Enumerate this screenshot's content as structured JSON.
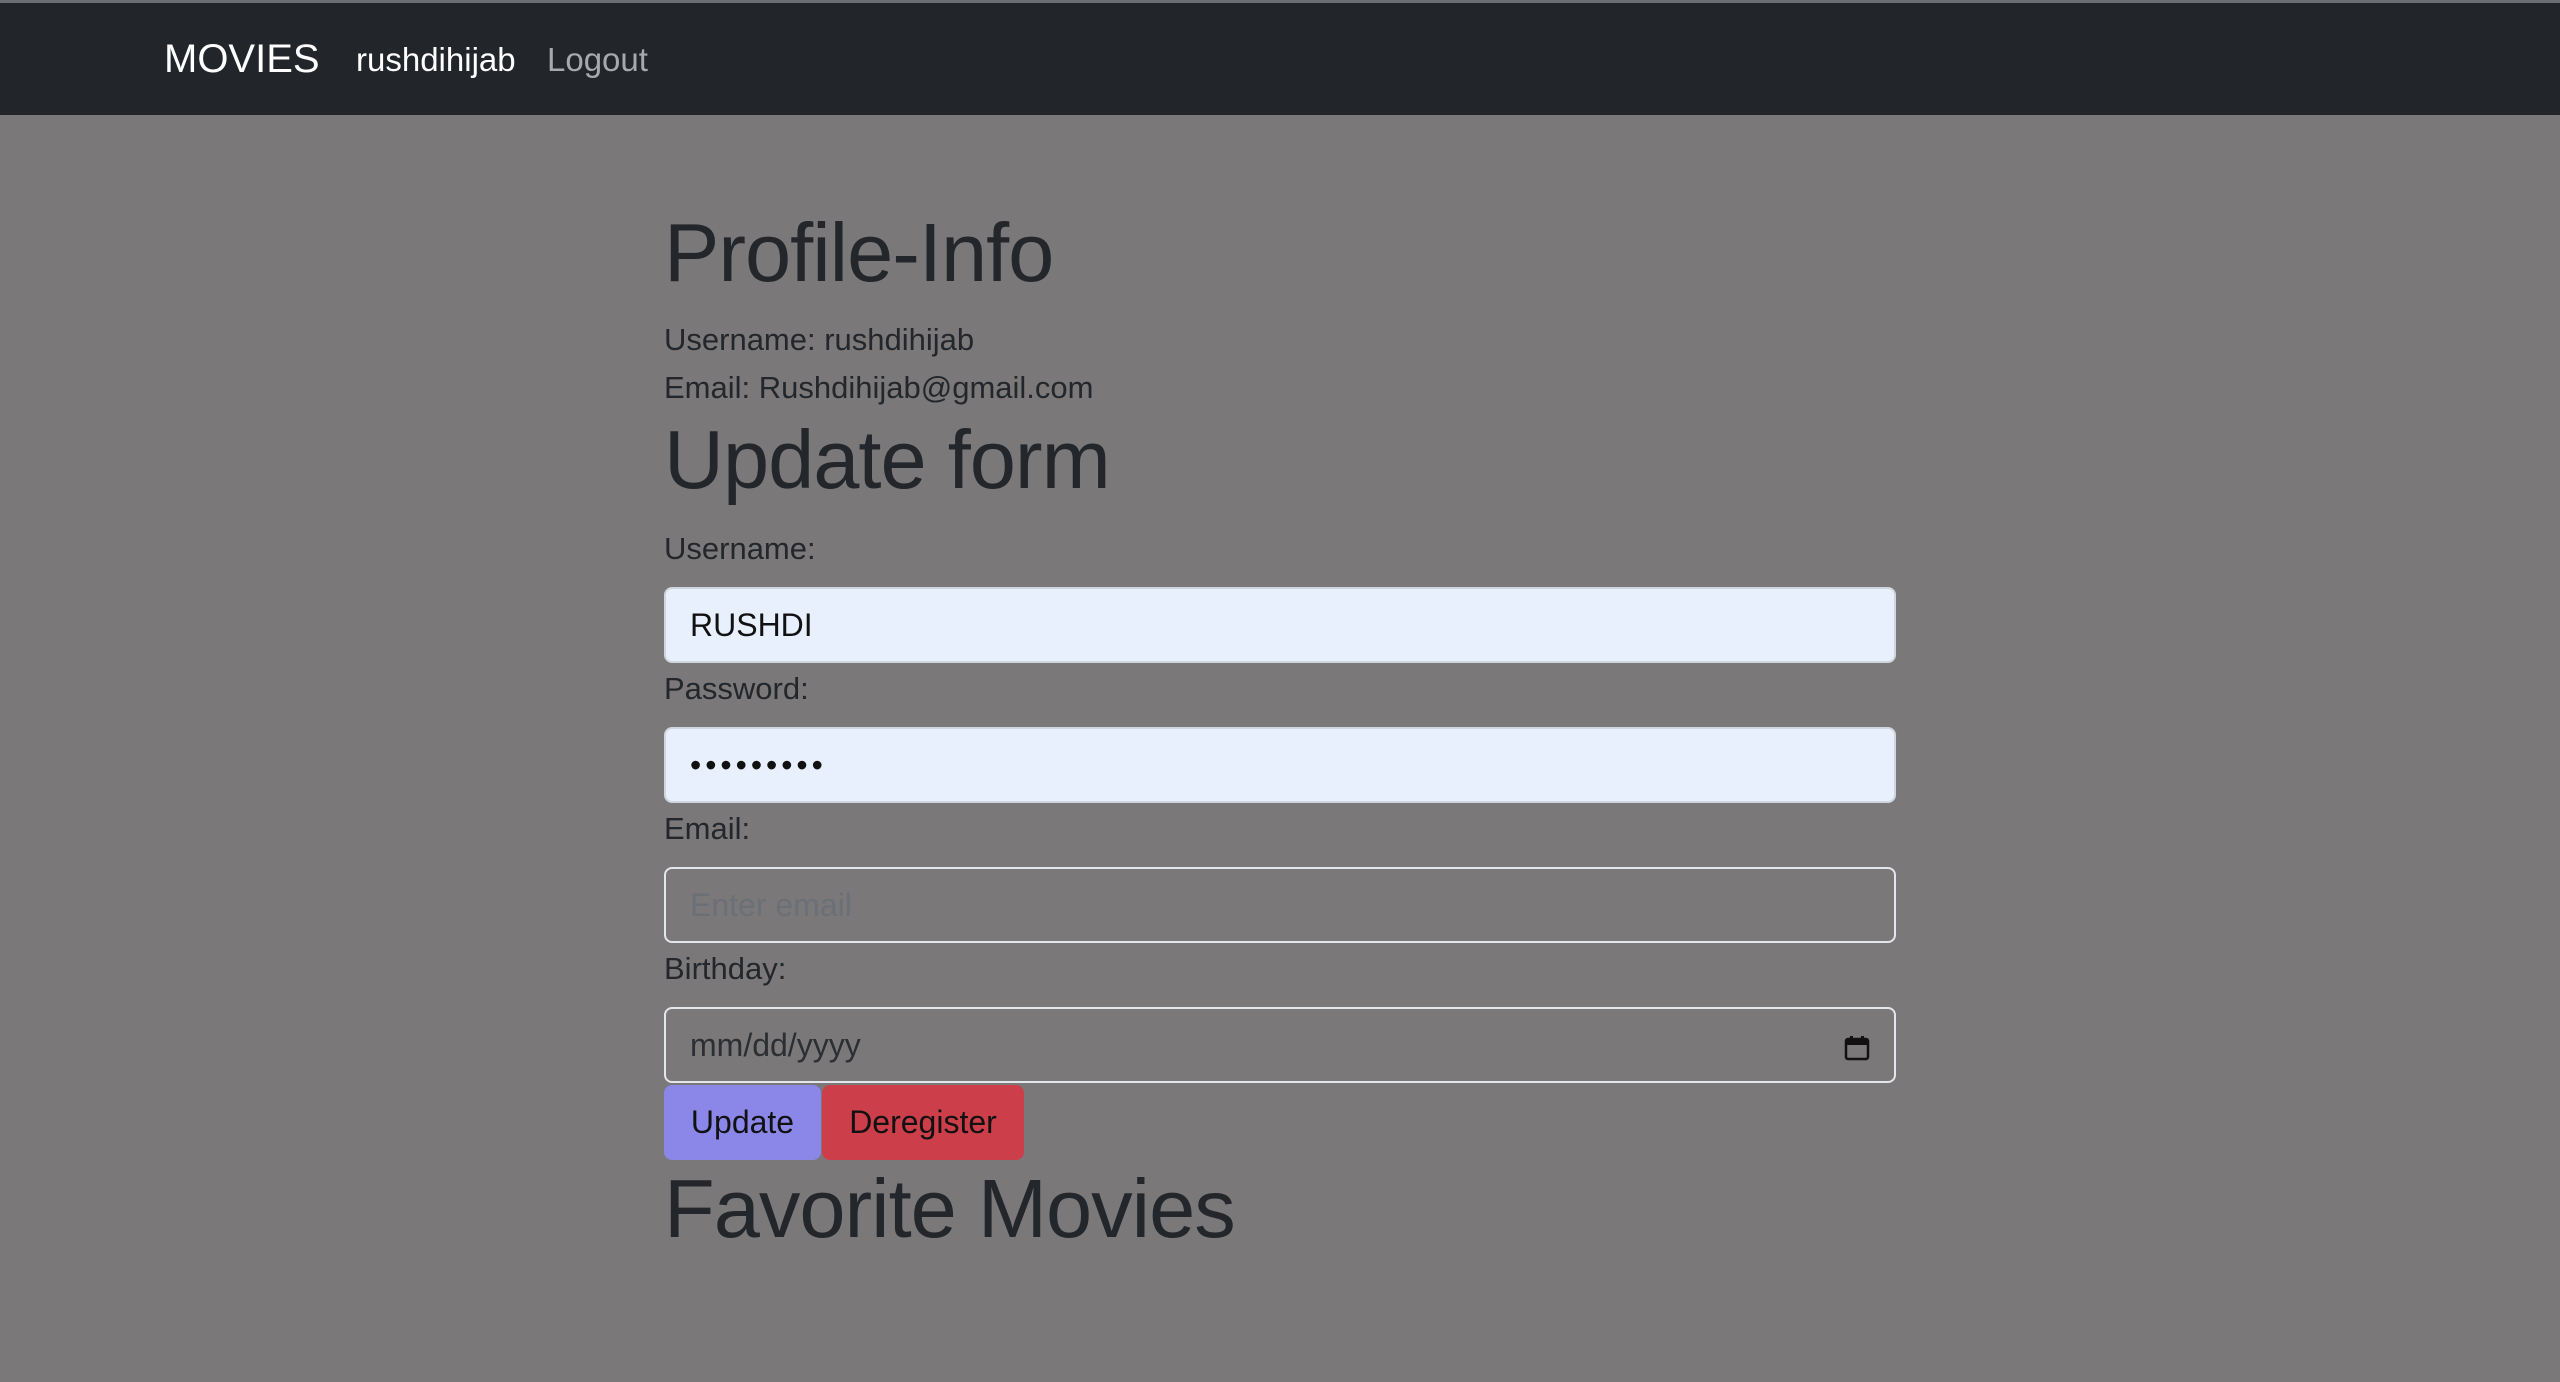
{
  "nav": {
    "brand": "MOVIES",
    "user": "rushdihijab",
    "logout": "Logout"
  },
  "profile": {
    "title": "Profile-Info",
    "username_line": "Username: rushdihijab",
    "email_line": "Email: Rushdihijab@gmail.com"
  },
  "form": {
    "title": "Update form",
    "username_label": "Username:",
    "username_value": "RUSHDI",
    "password_label": "Password:",
    "password_value": "•••••••••",
    "email_label": "Email:",
    "email_placeholder": "Enter email",
    "birthday_label": "Birthday:",
    "birthday_placeholder": "mm/dd/yyyy",
    "update_label": "Update",
    "deregister_label": "Deregister"
  },
  "favorites": {
    "title": "Favorite Movies"
  },
  "colors": {
    "navbar": "#22252a",
    "background": "#7a7879",
    "update_button": "#8b87e8",
    "deregister_button": "#cc3f4a",
    "autofill_field": "#e8f0fe"
  }
}
